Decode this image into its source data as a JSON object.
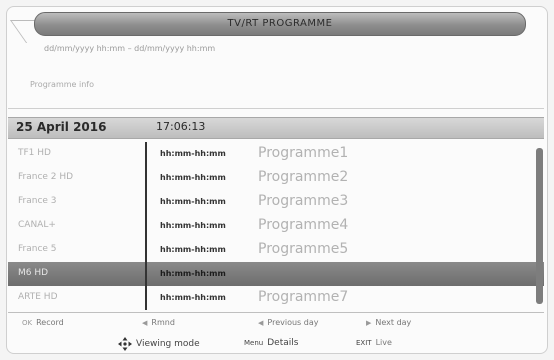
{
  "window": {
    "title": "TV/RT PROGRAMME",
    "date_line": "dd/mm/yyyy hh:mm – dd/mm/yyyy hh:mm",
    "info_line": "Programme info"
  },
  "header": {
    "date": "25 April 2016",
    "time": "17:06:13"
  },
  "channels": [
    {
      "channel": "TF1 HD",
      "time": "hh:mm-hh:mm",
      "programme": "Programme1",
      "selected": false
    },
    {
      "channel": "France 2 HD",
      "time": "hh:mm-hh:mm",
      "programme": "Programme2",
      "selected": false
    },
    {
      "channel": "France 3",
      "time": "hh:mm-hh:mm",
      "programme": "Programme3",
      "selected": false
    },
    {
      "channel": "CANAL+",
      "time": "hh:mm-hh:mm",
      "programme": "Programme4",
      "selected": false
    },
    {
      "channel": "France 5",
      "time": "hh:mm-hh:mm",
      "programme": "Programme5",
      "selected": false
    },
    {
      "channel": "M6 HD",
      "time": "hh:mm-hh:mm",
      "programme": "",
      "selected": true
    },
    {
      "channel": "ARTE HD",
      "time": "hh:mm-hh:mm",
      "programme": "Programme7",
      "selected": false
    }
  ],
  "footer": {
    "row1": [
      {
        "key": "OK",
        "label": "Record"
      },
      {
        "key": "◀",
        "label": "Rmnd"
      },
      {
        "key": "◀",
        "label": "Previous day"
      },
      {
        "key": "▶",
        "label": "Next day"
      }
    ],
    "row2": [
      {
        "icon": "dpad-icon",
        "label": "Viewing mode"
      },
      {
        "key": "Menu",
        "label": "Details"
      },
      {
        "key": "EXIT",
        "label": "Live"
      }
    ]
  }
}
